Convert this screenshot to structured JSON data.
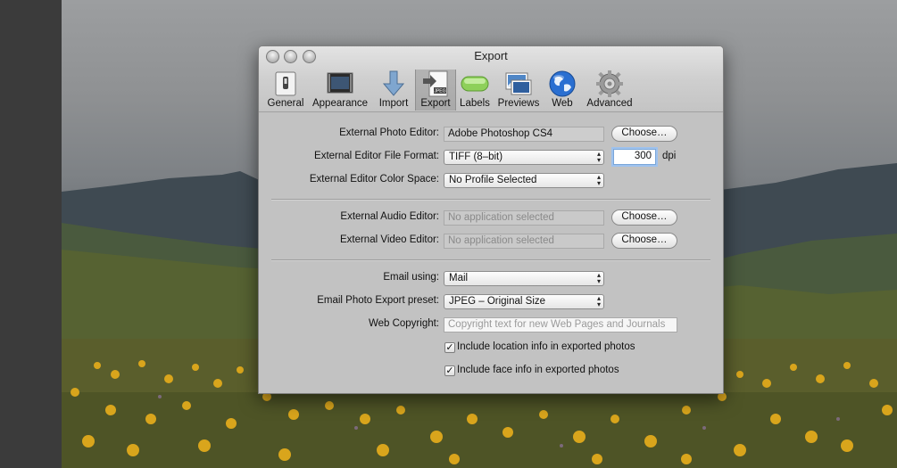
{
  "window": {
    "title": "Export"
  },
  "toolbar": {
    "items": [
      {
        "label": "General",
        "icon": "switch-icon"
      },
      {
        "label": "Appearance",
        "icon": "display-icon"
      },
      {
        "label": "Import",
        "icon": "arrow-down-icon"
      },
      {
        "label": "Export",
        "icon": "jpeg-export-icon",
        "selected": true
      },
      {
        "label": "Labels",
        "icon": "label-pill-icon"
      },
      {
        "label": "Previews",
        "icon": "previews-icon"
      },
      {
        "label": "Web",
        "icon": "globe-icon"
      },
      {
        "label": "Advanced",
        "icon": "gear-icon"
      }
    ],
    "jpeg_badge": "JPEG"
  },
  "external_editors": {
    "photo_editor_label": "External Photo Editor:",
    "photo_editor_value": "Adobe Photoshop CS4",
    "photo_choose": "Choose…",
    "file_format_label": "External Editor File Format:",
    "file_format_value": "TIFF (8–bit)",
    "dpi_value": "300",
    "dpi_unit": "dpi",
    "color_space_label": "External Editor Color Space:",
    "color_space_value": "No Profile Selected"
  },
  "media_editors": {
    "audio_label": "External Audio Editor:",
    "audio_placeholder": "No application selected",
    "audio_choose": "Choose…",
    "video_label": "External Video Editor:",
    "video_placeholder": "No application selected",
    "video_choose": "Choose…"
  },
  "email_web": {
    "email_label": "Email using:",
    "email_value": "Mail",
    "preset_label": "Email Photo Export preset:",
    "preset_value": "JPEG – Original Size",
    "copyright_label": "Web Copyright:",
    "copyright_placeholder": "Copyright text for new Web Pages and Journals",
    "include_location": "Include location info in exported photos",
    "include_location_checked": true,
    "include_face": "Include face info in exported photos",
    "include_face_checked": true,
    "check_glyph": "✓"
  },
  "colors": {
    "window_bg": "#c2c2c2",
    "focus_ring": "#9ec2ee",
    "globe_blue": "#2a6fd1",
    "label_green": "#8ed05a"
  }
}
